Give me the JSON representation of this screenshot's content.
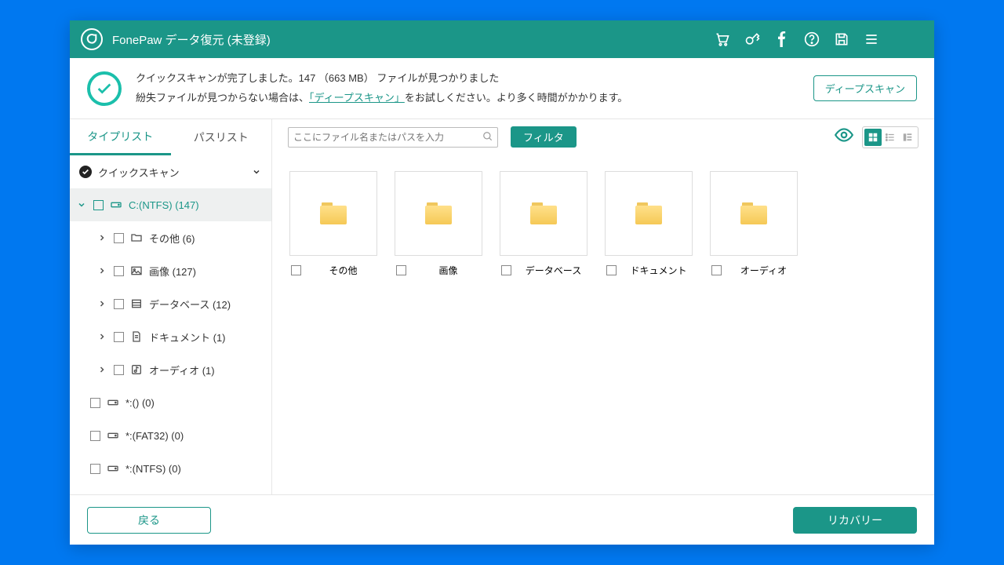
{
  "title": "FonePaw データ復元 (未登録)",
  "status": {
    "line1": "クイックスキャンが完了しました。147 （663 MB） ファイルが見つかりました",
    "line2a": "紛失ファイルが見つからない場合は、",
    "link": "「ディープスキャン」",
    "line2b": "をお試しください。より多く時間がかかります。",
    "deep_btn": "ディープスキャン"
  },
  "tabs": {
    "type": "タイプリスト",
    "path": "パスリスト"
  },
  "tree": {
    "root": "クイックスキャン",
    "drive": "C:(NTFS) (147)",
    "items": [
      {
        "label": "その他 (6)"
      },
      {
        "label": "画像 (127)"
      },
      {
        "label": "データベース (12)"
      },
      {
        "label": "ドキュメント (1)"
      },
      {
        "label": "オーディオ (1)"
      }
    ],
    "extras": [
      {
        "label": "*:() (0)"
      },
      {
        "label": "*:(FAT32) (0)"
      },
      {
        "label": "*:(NTFS) (0)"
      }
    ]
  },
  "search": {
    "placeholder": "ここにファイル名またはパスを入力"
  },
  "filter": "フィルタ",
  "folders": [
    {
      "label": "その他"
    },
    {
      "label": "画像"
    },
    {
      "label": "データベース"
    },
    {
      "label": "ドキュメント"
    },
    {
      "label": "オーディオ"
    }
  ],
  "footer": {
    "back": "戻る",
    "recover": "リカバリー"
  }
}
